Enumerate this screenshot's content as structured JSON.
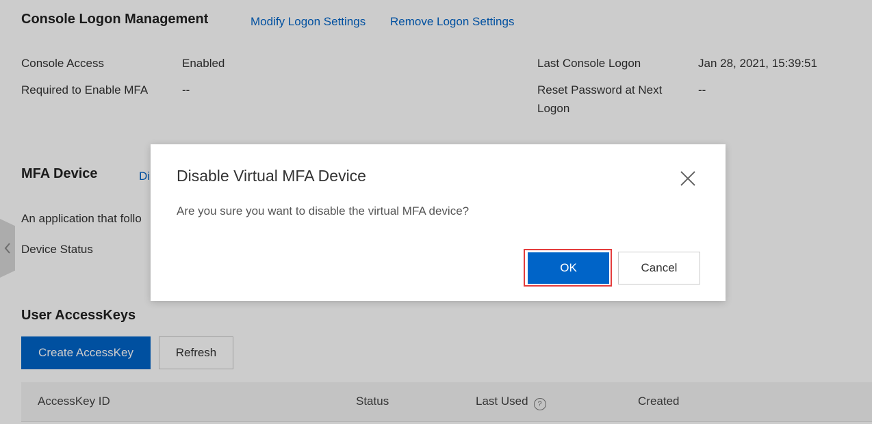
{
  "logon": {
    "title": "Console Logon Management",
    "modify_link": "Modify Logon Settings",
    "remove_link": "Remove Logon Settings",
    "console_access_label": "Console Access",
    "console_access_value": "Enabled",
    "mfa_required_label": "Required to Enable MFA",
    "mfa_required_value": "--",
    "last_logon_label": "Last Console Logon",
    "last_logon_value": "Jan 28, 2021, 15:39:51",
    "reset_password_label_line1": "Reset Password at Next",
    "reset_password_label_line2": "Logon",
    "reset_password_value": "--"
  },
  "mfa": {
    "title": "MFA Device",
    "disable_link_partial": "Di",
    "description_partial": "An application that follo",
    "device_status_label": "Device Status"
  },
  "access_keys": {
    "title": "User AccessKeys",
    "create_button": "Create AccessKey",
    "refresh_button": "Refresh",
    "columns": [
      "AccessKey ID",
      "Status",
      "Last Used",
      "Created"
    ]
  },
  "modal": {
    "title": "Disable Virtual MFA Device",
    "message": "Are you sure you want to disable the virtual MFA device?",
    "ok_button": "OK",
    "cancel_button": "Cancel"
  },
  "icons": {
    "close": "close-icon",
    "help": "help-circle-icon",
    "side_collapse": "chevron-left-icon"
  },
  "colors": {
    "primary": "#0064c8",
    "highlight": "#e43c3c"
  }
}
